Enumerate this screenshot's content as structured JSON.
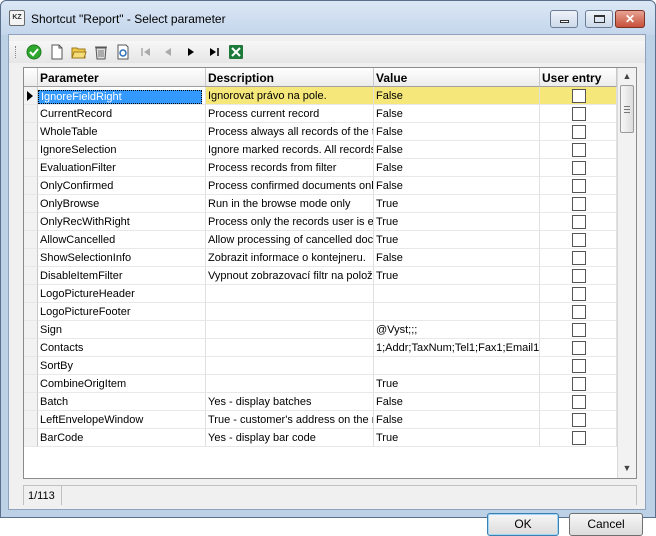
{
  "window": {
    "app_icon_text": "KZ",
    "title": "Shortcut \"Report\" - Select parameter",
    "close_glyph": "✕"
  },
  "toolbar": {
    "icons": [
      "check-icon",
      "new-document-icon",
      "open-folder-icon",
      "delete-bin-icon",
      "refresh-document-icon",
      "first-record-icon",
      "previous-record-icon",
      "next-record-icon",
      "last-record-icon",
      "excel-export-icon"
    ]
  },
  "grid": {
    "columns": {
      "parameter": "Parameter",
      "description": "Description",
      "value": "Value",
      "user_entry": "User entry"
    },
    "rows": [
      {
        "parameter": "IgnoreFieldRight",
        "description": "Ignorovat právo na pole.",
        "value": "False",
        "user_entry": false
      },
      {
        "parameter": "CurrentRecord",
        "description": "Process current record",
        "value": "False",
        "user_entry": false
      },
      {
        "parameter": "WholeTable",
        "description": "Process always all records of the ta",
        "value": "False",
        "user_entry": false
      },
      {
        "parameter": "IgnoreSelection",
        "description": "Ignore marked records. All records",
        "value": "False",
        "user_entry": false
      },
      {
        "parameter": "EvaluationFilter",
        "description": "Process records from filter",
        "value": "False",
        "user_entry": false
      },
      {
        "parameter": "OnlyConfirmed",
        "description": "Process confirmed documents only",
        "value": "False",
        "user_entry": false
      },
      {
        "parameter": "OnlyBrowse",
        "description": "Run in the browse mode only",
        "value": "True",
        "user_entry": false
      },
      {
        "parameter": "OnlyRecWithRight",
        "description": "Process only the records user is en",
        "value": "True",
        "user_entry": false
      },
      {
        "parameter": "AllowCancelled",
        "description": "Allow processing of cancelled docu",
        "value": "True",
        "user_entry": false
      },
      {
        "parameter": "ShowSelectionInfo",
        "description": "Zobrazit informace o kontejneru.",
        "value": "False",
        "user_entry": false
      },
      {
        "parameter": "DisableItemFilter",
        "description": "Vypnout zobrazovací filtr na polož",
        "value": "True",
        "user_entry": false
      },
      {
        "parameter": "LogoPictureHeader",
        "description": "",
        "value": "",
        "user_entry": false
      },
      {
        "parameter": "LogoPictureFooter",
        "description": "",
        "value": "",
        "user_entry": false
      },
      {
        "parameter": "Sign",
        "description": "",
        "value": "@Vyst;;;",
        "user_entry": false
      },
      {
        "parameter": "Contacts",
        "description": "",
        "value": "1;Addr;TaxNum;Tel1;Fax1;Email1;\\",
        "user_entry": false
      },
      {
        "parameter": "SortBy",
        "description": "",
        "value": "",
        "user_entry": false
      },
      {
        "parameter": "CombineOrigItem",
        "description": "",
        "value": "True",
        "user_entry": false
      },
      {
        "parameter": "Batch",
        "description": "Yes - display batches",
        "value": "False",
        "user_entry": false
      },
      {
        "parameter": "LeftEnvelopeWindow",
        "description": "True - customer's address on the ri",
        "value": "False",
        "user_entry": false
      },
      {
        "parameter": "BarCode",
        "description": "Yes - display bar code",
        "value": "True",
        "user_entry": false
      }
    ],
    "selected_index": 0
  },
  "scrollbar": {
    "up": "▲",
    "down": "▼"
  },
  "status": {
    "record_position": "1/113"
  },
  "buttons": {
    "ok": "OK",
    "cancel": "Cancel"
  }
}
